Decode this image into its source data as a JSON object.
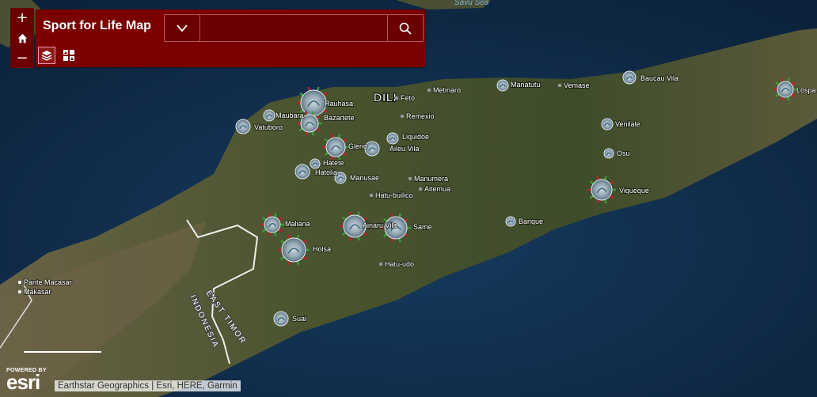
{
  "app": {
    "title": "Sport for Life Map",
    "search_placeholder": "",
    "zoom_in": "+",
    "zoom_out": "−"
  },
  "map": {
    "sea_label": "Savu Sea",
    "capital_label": "DILI",
    "country_labels": [
      "EAST TIMOR",
      "INDONESIA"
    ],
    "cluster_places": [
      "Rauhasa",
      "Maubara",
      "Vatuboro",
      "Bazartete",
      "Gleno",
      "Hatete",
      "Hatolia",
      "Manusae",
      "Ainaru Vila",
      "Same",
      "Maliana",
      "Holsa",
      "Suai",
      "Baucau Vila",
      "Venilale",
      "Osu",
      "Viqueque",
      "Lospa",
      "Manatutu",
      "Barique",
      "Liquidoe",
      "Aileu Vila"
    ],
    "point_places": [
      "Feto",
      "Remexio",
      "Metinaro",
      "Vemase",
      "Manumera",
      "Aitemua",
      "Hatu-builico",
      "Hatu-udo",
      "Pante Macasar",
      "Makasar"
    ],
    "attribution": "Earthstar Geographics | Esri, HERE, Garmin",
    "powered_by": "POWERED BY",
    "logo_text": "esri"
  },
  "colors": {
    "header": "#7a0000",
    "water": "#0d2a4a",
    "land": "#4a4b2c",
    "marker": "#9fb3bf"
  }
}
